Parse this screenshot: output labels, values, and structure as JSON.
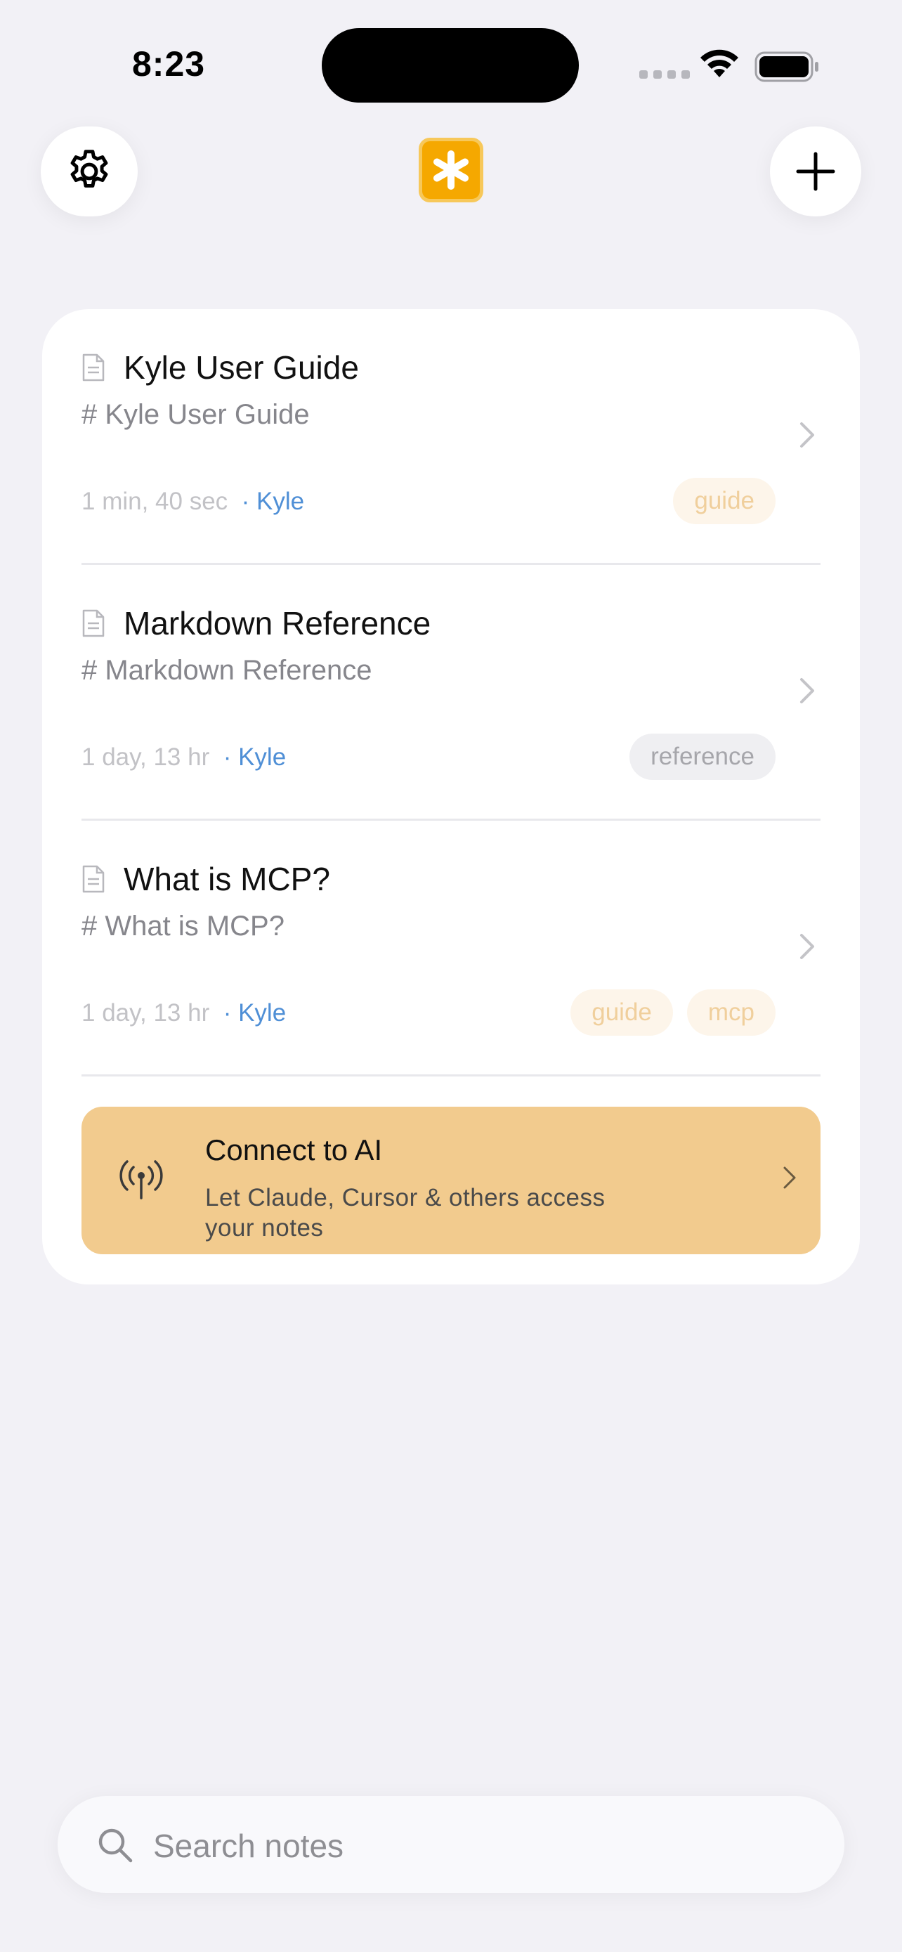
{
  "status_bar": {
    "time": "8:23"
  },
  "header": {
    "settings_icon": "gear-icon",
    "logo_icon": "asterisk-logo-icon",
    "add_icon": "plus-icon"
  },
  "notes": [
    {
      "title": "Kyle User Guide",
      "preview": "# Kyle User Guide",
      "time": "1 min, 40 sec",
      "author": "· Kyle",
      "tags": [
        "guide"
      ]
    },
    {
      "title": "Markdown Reference",
      "preview": "# Markdown Reference",
      "time": "1 day, 13 hr",
      "author": "· Kyle",
      "tags": [
        "reference"
      ]
    },
    {
      "title": "What is MCP?",
      "preview": "# What is MCP?",
      "time": "1 day, 13 hr",
      "author": "· Kyle",
      "tags": [
        "guide",
        "mcp"
      ]
    }
  ],
  "connect": {
    "title": "Connect to AI",
    "subtitle": "Let Claude, Cursor & others access your notes",
    "icon": "antenna-icon"
  },
  "search": {
    "placeholder": "Search notes"
  },
  "colors": {
    "accent": "#f5a800",
    "connect_bg": "#f2cb8e",
    "author_link": "#4f8fd6",
    "background": "#f2f1f6"
  }
}
